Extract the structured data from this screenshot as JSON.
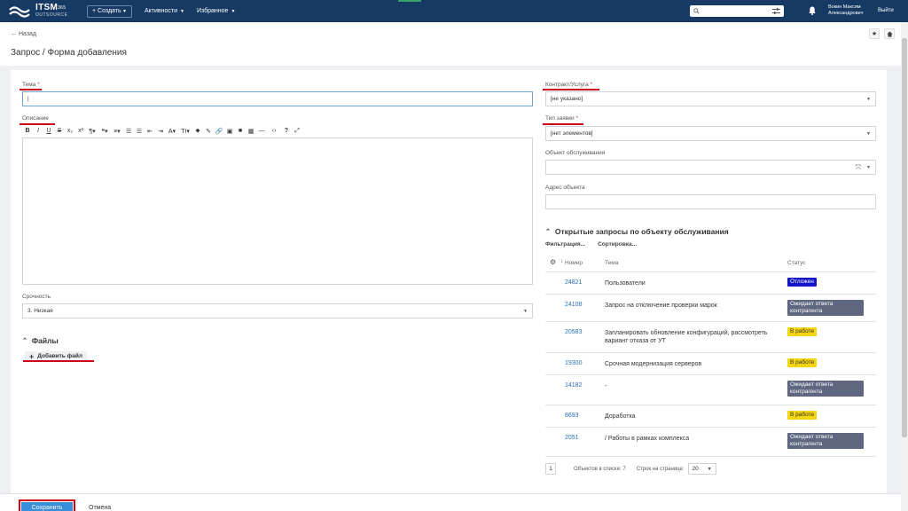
{
  "app": {
    "logo_title": "ITSM",
    "logo_sup": "365",
    "logo_sub": "OUTSOURCE",
    "create_label": "+ Создать",
    "nav": [
      {
        "label": "Активности"
      },
      {
        "label": "Избранное"
      }
    ],
    "search_placeholder": "",
    "user_line1": "Вокин Максим",
    "user_line2": "Александрович",
    "logout_label": "Выйти"
  },
  "page": {
    "back_label": "← Назад",
    "title": "Запрос / Форма добавления"
  },
  "form": {
    "topic_label": "Тема",
    "topic_value": "|",
    "description_label": "Описание",
    "urgency_label": "Срочность",
    "urgency_value": "3. Низкая",
    "files_header": "Файлы",
    "add_file_label": "Добавить файл",
    "contract_label": "Контракт/Услуга",
    "contract_value": "[не указано]",
    "request_type_label": "Тип заявки",
    "request_type_value": "[нет элементов]",
    "service_object_label": "Объект обслуживания",
    "service_object_value": "",
    "object_address_label": "Адрес объекта",
    "object_address_value": "",
    "required_mark": "*"
  },
  "toolbar": {
    "buttons": [
      "B",
      "I",
      "U",
      "S",
      "x₂",
      "x²",
      "¶▾",
      "❝▾",
      "≡▾",
      "☰",
      "☰",
      "⇤",
      "⇥",
      "A▾",
      "TI▾",
      "⬥",
      "✎",
      "🔗",
      "▣",
      "■",
      "▦",
      "—",
      "‹›",
      "?",
      "⤢"
    ]
  },
  "open_requests": {
    "header": "Открытые запросы по объекту обслуживания",
    "filter_label": "Фильтрация...",
    "sort_label": "Сортировка...",
    "col_number": "Номер",
    "col_topic": "Тема",
    "col_status": "Статус",
    "rows": [
      {
        "number": "24821",
        "topic": "Пользователи",
        "status": "Отложен",
        "status_type": "blue",
        "height": 25
      },
      {
        "number": "24108",
        "topic": "Запрос на отключение проверки марок",
        "status": "Ожидает ответа контрагента",
        "status_type": "grey",
        "height": 31
      },
      {
        "number": "20583",
        "topic": "Запланировать обновление конфигураций, рассмотреть вариант отказа от УТ",
        "status": "В работе",
        "status_type": "yellow",
        "height": 35
      },
      {
        "number": "19300",
        "topic": "Срочная модернизация серверов",
        "status": "В работе",
        "status_type": "yellow",
        "height": 25
      },
      {
        "number": "14182",
        "topic": "-",
        "status": "Ожидает ответа контрагента",
        "status_type": "grey",
        "height": 34
      },
      {
        "number": "8693",
        "topic": "Доработка",
        "status": "В работе",
        "status_type": "yellow",
        "height": 25
      },
      {
        "number": "2051",
        "topic": "/ Работы в рамках комплекса",
        "status": "Ожидает ответа контрагента",
        "status_type": "grey",
        "height": 33
      }
    ],
    "pager_page": "1",
    "objects_in_list": "Объектов в списке: 7",
    "rows_per_page_label": "Строк на странице:",
    "rows_per_page": "20"
  },
  "footer": {
    "save_label": "Сохранить",
    "cancel_label": "Отмена"
  },
  "colors": {
    "topbar": "#163a63",
    "accent_red": "#d0021b",
    "link": "#2a6cb3",
    "status_blue": "#1515c8",
    "status_grey": "#5f6680",
    "status_yellow": "#f5d50f"
  }
}
